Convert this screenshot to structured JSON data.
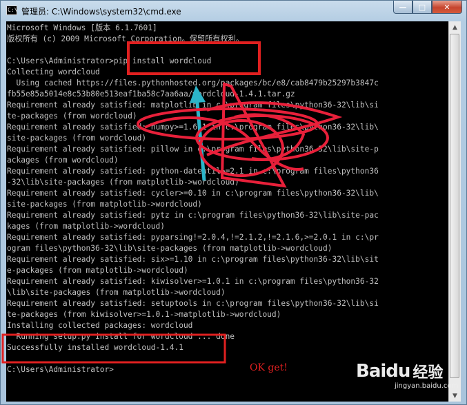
{
  "window": {
    "title": "管理员: C:\\Windows\\system32\\cmd.exe",
    "icon": "cmd-app-icon",
    "buttons": {
      "minimize": "minimize-icon",
      "maximize": "maximize-icon",
      "close": "close-icon"
    }
  },
  "console": {
    "lines": [
      "Microsoft Windows [版本 6.1.7601]",
      "版权所有 (c) 2009 Microsoft Corporation。保留所有权利。",
      "",
      "C:\\Users\\Administrator>pip install wordcloud",
      "Collecting wordcloud",
      "  Using cached https://files.pythonhosted.org/packages/bc/e8/cab8479b25297b3847c",
      "fb55e85a5014e8c53b80e513eaf1ba58c7aa6aa/wordcloud-1.4.1.tar.gz",
      "Requirement already satisfied: matplotlib in c:\\program files\\python36-32\\lib\\si",
      "te-packages (from wordcloud)",
      "Requirement already satisfied: numpy>=1.6.1 in c:\\program files\\python36-32\\lib\\",
      "site-packages (from wordcloud)",
      "Requirement already satisfied: pillow in c:\\program files\\python36-32\\lib\\site-p",
      "ackages (from wordcloud)",
      "Requirement already satisfied: python-dateutil>=2.1 in c:\\program files\\python36",
      "-32\\lib\\site-packages (from matplotlib->wordcloud)",
      "Requirement already satisfied: cycler>=0.10 in c:\\program files\\python36-32\\lib\\",
      "site-packages (from matplotlib->wordcloud)",
      "Requirement already satisfied: pytz in c:\\program files\\python36-32\\lib\\site-pac",
      "kages (from matplotlib->wordcloud)",
      "Requirement already satisfied: pyparsing!=2.0.4,!=2.1.2,!=2.1.6,>=2.0.1 in c:\\pr",
      "ogram files\\python36-32\\lib\\site-packages (from matplotlib->wordcloud)",
      "Requirement already satisfied: six>=1.10 in c:\\program files\\python36-32\\lib\\sit",
      "e-packages (from matplotlib->wordcloud)",
      "Requirement already satisfied: kiwisolver>=1.0.1 in c:\\program files\\python36-32",
      "\\lib\\site-packages (from matplotlib->wordcloud)",
      "Requirement already satisfied: setuptools in c:\\program files\\python36-32\\lib\\si",
      "te-packages (from kiwisolver>=1.0.1->matplotlib->wordcloud)",
      "Installing collected packages: wordcloud",
      "  Running setup.py install for wordcloud ... done",
      "Successfully installed wordcloud-1.4.1",
      "",
      "C:\\Users\\Administrator>"
    ]
  },
  "annotation": {
    "text": "OK get!",
    "color": "#e02020"
  },
  "watermark": {
    "brand": "Baidu",
    "brand_cn": "经验",
    "url": "jingyan.baidu.com"
  },
  "colors": {
    "console_bg": "#000000",
    "console_fg": "#c0c0c0",
    "annotation_red": "#e02020",
    "arrow_cyan": "#2bb5c9"
  }
}
